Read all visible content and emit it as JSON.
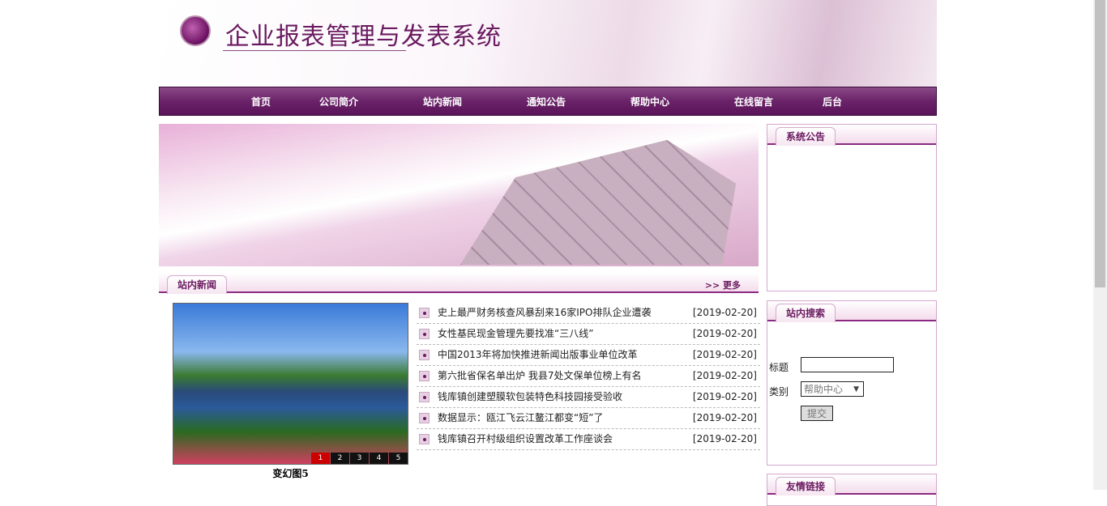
{
  "header": {
    "title": "企业报表管理与发表系统"
  },
  "nav": [
    {
      "label": "首页"
    },
    {
      "label": "公司简介"
    },
    {
      "label": "站内新闻"
    },
    {
      "label": "通知公告"
    },
    {
      "label": "帮助中心"
    },
    {
      "label": "在线留言"
    },
    {
      "label": "后台"
    }
  ],
  "news": {
    "tab": "站内新闻",
    "more": ">> 更多",
    "slideshow": {
      "caption": "变幻图5",
      "pages": [
        "1",
        "2",
        "3",
        "4",
        "5"
      ],
      "active": "1"
    },
    "items": [
      {
        "title": "史上最严财务核查风暴刮来16家IPO排队企业遭袭",
        "date": "[2019-02-20]"
      },
      {
        "title": "女性基民现金管理先要找准“三八线”",
        "date": "[2019-02-20]"
      },
      {
        "title": "中国2013年将加快推进新闻出版事业单位改革",
        "date": "[2019-02-20]"
      },
      {
        "title": "第六批省保名单出炉 我县7处文保单位榜上有名",
        "date": "[2019-02-20]"
      },
      {
        "title": "钱库镇创建塑膜软包装特色科技园接受验收",
        "date": "[2019-02-20]"
      },
      {
        "title": "数据显示：瓯江飞云江鳌江都变“短”了",
        "date": "[2019-02-20]"
      },
      {
        "title": "钱库镇召开村级组织设置改革工作座谈会",
        "date": "[2019-02-20]"
      }
    ]
  },
  "sidebar": {
    "notice_tab": "系统公告",
    "search_tab": "站内搜索",
    "title_label": "标题",
    "title_value": "",
    "category_label": "类别",
    "category_value": "帮助中心",
    "submit": "提交",
    "links_tab": "友情链接"
  }
}
